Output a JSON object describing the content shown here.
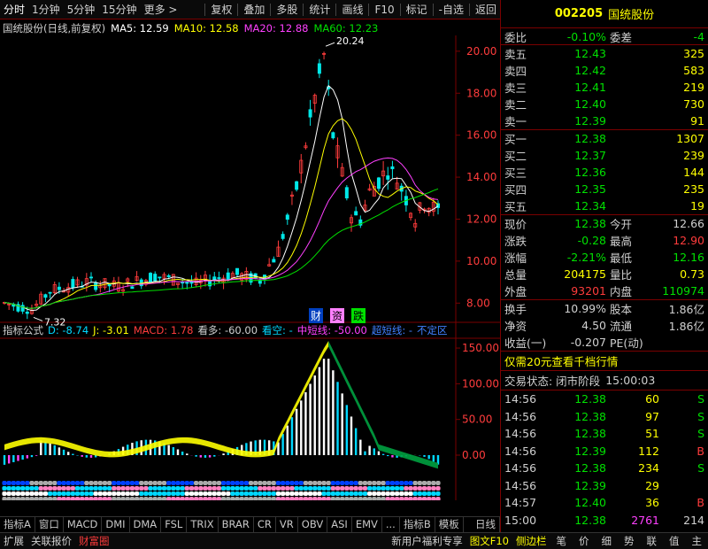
{
  "toolbar": {
    "left": [
      "分时",
      "1分钟",
      "5分钟",
      "15分钟",
      "更多 >"
    ],
    "right": [
      "复权",
      "叠加",
      "多股",
      "统计",
      "画线",
      "F10",
      "标记",
      "-自选",
      "返回"
    ]
  },
  "main_indicator": {
    "name": "国统股份(日线,前复权)",
    "ma5": "MA5: 12.59",
    "ma10": "MA10: 12.58",
    "ma20": "MA20: 12.88",
    "ma60": "MA60: 12.23"
  },
  "chart": {
    "price_ticks": [
      "20.00",
      "18.00",
      "16.00",
      "14.00",
      "12.00",
      "10.00",
      "8.00"
    ],
    "high_label": "20.24",
    "low_label": "7.32",
    "badges": [
      "财",
      "资",
      "跌"
    ],
    "macd_ticks": [
      "150.00",
      "100.00",
      "50.00",
      "0.00"
    ],
    "months": [
      "2022年",
      "3",
      "4",
      "5",
      "6"
    ],
    "period_label": "日线",
    "colors": {
      "up": "#ff3c3c",
      "down": "#00e8e8",
      "ma5": "#ffffff",
      "ma10": "#ffff00",
      "ma20": "#ff40ff",
      "ma60": "#00e000",
      "grid": "#7a0000"
    }
  },
  "sub_indicator": {
    "name": "指标公式",
    "d": "D: -8.74",
    "j": "J: -3.01",
    "macd": "MACD: 1.78",
    "kanduo": "看多: -60.00",
    "kankong": "看空: -",
    "zhongduan": "中短线: -50.00",
    "chaoduan": "超短线: -",
    "buding": "不定区"
  },
  "bottom_tabs": [
    "指标A",
    "窗口",
    "MACD",
    "DMI",
    "DMA",
    "FSL",
    "TRIX",
    "BRAR",
    "CR",
    "VR",
    "OBV",
    "ASI",
    "EMV",
    "...",
    "指标B",
    "模板"
  ],
  "status_bar": {
    "left": [
      "扩展",
      "关联报价",
      "财富圈"
    ],
    "promo": "新用户福利专享",
    "chart_tab": "图文F10",
    "sidebar": "侧边栏",
    "right": [
      "笔",
      "价",
      "细",
      "势",
      "联",
      "值",
      "主"
    ]
  },
  "quote": {
    "code": "002205",
    "name": "国统股份",
    "weibi_label": "委比",
    "weibi": "-0.10%",
    "weicha_label": "委差",
    "weicha": "-4",
    "sell": [
      {
        "label": "卖五",
        "price": "12.43",
        "vol": "325"
      },
      {
        "label": "卖四",
        "price": "12.42",
        "vol": "583"
      },
      {
        "label": "卖三",
        "price": "12.41",
        "vol": "219"
      },
      {
        "label": "卖二",
        "price": "12.40",
        "vol": "730"
      },
      {
        "label": "卖一",
        "price": "12.39",
        "vol": "91"
      }
    ],
    "buy": [
      {
        "label": "买一",
        "price": "12.38",
        "vol": "1307"
      },
      {
        "label": "买二",
        "price": "12.37",
        "vol": "239"
      },
      {
        "label": "买三",
        "price": "12.36",
        "vol": "144"
      },
      {
        "label": "买四",
        "price": "12.35",
        "vol": "235"
      },
      {
        "label": "买五",
        "price": "12.34",
        "vol": "19"
      }
    ],
    "stats": [
      {
        "l1": "现价",
        "v1": "12.38",
        "c1": "c-g",
        "l2": "今开",
        "v2": "12.66",
        "c2": "c-w"
      },
      {
        "l1": "涨跌",
        "v1": "-0.28",
        "c1": "c-g",
        "l2": "最高",
        "v2": "12.90",
        "c2": "c-r"
      },
      {
        "l1": "涨幅",
        "v1": "-2.21%",
        "c1": "c-g",
        "l2": "最低",
        "v2": "12.16",
        "c2": "c-g"
      },
      {
        "l1": "总量",
        "v1": "204175",
        "c1": "c-y",
        "l2": "量比",
        "v2": "0.73",
        "c2": "c-y"
      },
      {
        "l1": "外盘",
        "v1": "93201",
        "c1": "c-r",
        "l2": "内盘",
        "v2": "110974",
        "c2": "c-g"
      }
    ],
    "stats2": [
      {
        "l1": "换手",
        "v1": "10.99%",
        "l2": "股本",
        "v2": "1.86亿"
      },
      {
        "l1": "净资",
        "v1": "4.50",
        "l2": "流通",
        "v2": "1.86亿"
      },
      {
        "l1": "收益(一)",
        "v1": "-0.207",
        "l2": "PE(动)",
        "v2": ""
      }
    ],
    "promo": "仅需20元查看千档行情",
    "status": "交易状态: 闭市阶段",
    "status_time": "15:00:03",
    "ticks": [
      {
        "t": "14:56",
        "p": "12.38",
        "v": "60",
        "s": "S"
      },
      {
        "t": "14:56",
        "p": "12.38",
        "v": "97",
        "s": "S"
      },
      {
        "t": "14:56",
        "p": "12.38",
        "v": "51",
        "s": "S"
      },
      {
        "t": "14:56",
        "p": "12.39",
        "v": "112",
        "s": "B"
      },
      {
        "t": "14:56",
        "p": "12.38",
        "v": "234",
        "s": "S"
      },
      {
        "t": "14:56",
        "p": "12.39",
        "v": "29",
        "s": ""
      },
      {
        "t": "14:57",
        "p": "12.40",
        "v": "36",
        "s": "B"
      },
      {
        "t": "15:00",
        "p": "12.38",
        "v": "2761",
        "s": "214"
      }
    ]
  }
}
